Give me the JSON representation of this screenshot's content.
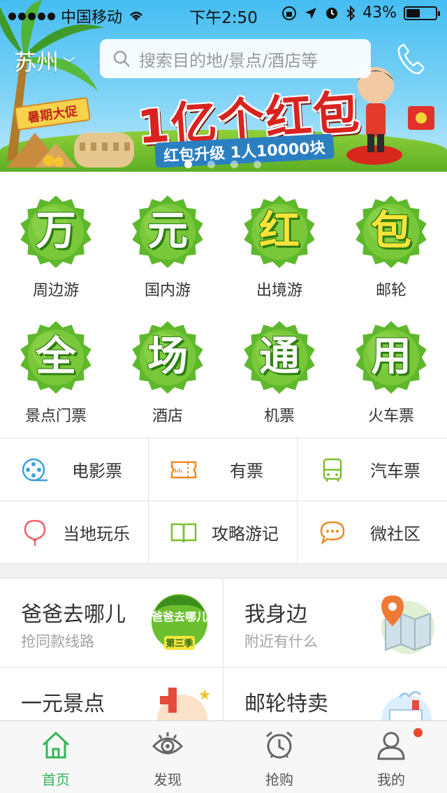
{
  "status_bar": {
    "carrier": "中国移动",
    "time": "下午2:50",
    "battery": "43%"
  },
  "header": {
    "city": "苏州",
    "search_placeholder": "搜索目的地/景点/酒店等"
  },
  "banner": {
    "tag": "暑期大促",
    "title": "1亿个红包",
    "subtitle": "红包升级 1人10000块",
    "slide_count": 5,
    "active_slide": 1
  },
  "categories": [
    {
      "badge": "万",
      "label": "周边游"
    },
    {
      "badge": "元",
      "label": "国内游"
    },
    {
      "badge": "红",
      "label": "出境游"
    },
    {
      "badge": "包",
      "label": "邮轮"
    },
    {
      "badge": "全",
      "label": "景点门票"
    },
    {
      "badge": "场",
      "label": "酒店"
    },
    {
      "badge": "通",
      "label": "机票"
    },
    {
      "badge": "用",
      "label": "火车票"
    }
  ],
  "services": [
    {
      "label": "电影票",
      "icon": "film-reel-icon",
      "color": "#3aa0e0"
    },
    {
      "label": "有票",
      "icon": "ticket-icon",
      "color": "#f08a24"
    },
    {
      "label": "汽车票",
      "icon": "bus-icon",
      "color": "#7cbf2f"
    },
    {
      "label": "当地玩乐",
      "icon": "balloon-icon",
      "color": "#ef5f6b"
    },
    {
      "label": "攻略游记",
      "icon": "book-icon",
      "color": "#7cbf2f"
    },
    {
      "label": "微社区",
      "icon": "chat-bubble-icon",
      "color": "#f08a24"
    }
  ],
  "features": [
    {
      "title": "爸爸去哪儿",
      "subtitle": "抢同款线路"
    },
    {
      "title": "我身边",
      "subtitle": "附近有什么"
    },
    {
      "title": "一元景点",
      "subtitle": ""
    },
    {
      "title": "邮轮特卖",
      "subtitle": ""
    }
  ],
  "feature_logo_text": "爸爸去哪儿",
  "feature_logo_sub": "第三季",
  "tabs": [
    {
      "label": "首页",
      "icon": "home-icon",
      "active": true
    },
    {
      "label": "发现",
      "icon": "eye-icon",
      "active": false
    },
    {
      "label": "抢购",
      "icon": "alarm-clock-icon",
      "active": false
    },
    {
      "label": "我的",
      "icon": "user-icon",
      "active": false
    }
  ],
  "colors": {
    "accent_green": "#36b45a",
    "badge_green": "#5fb82c",
    "notification_red": "#e9482d"
  }
}
